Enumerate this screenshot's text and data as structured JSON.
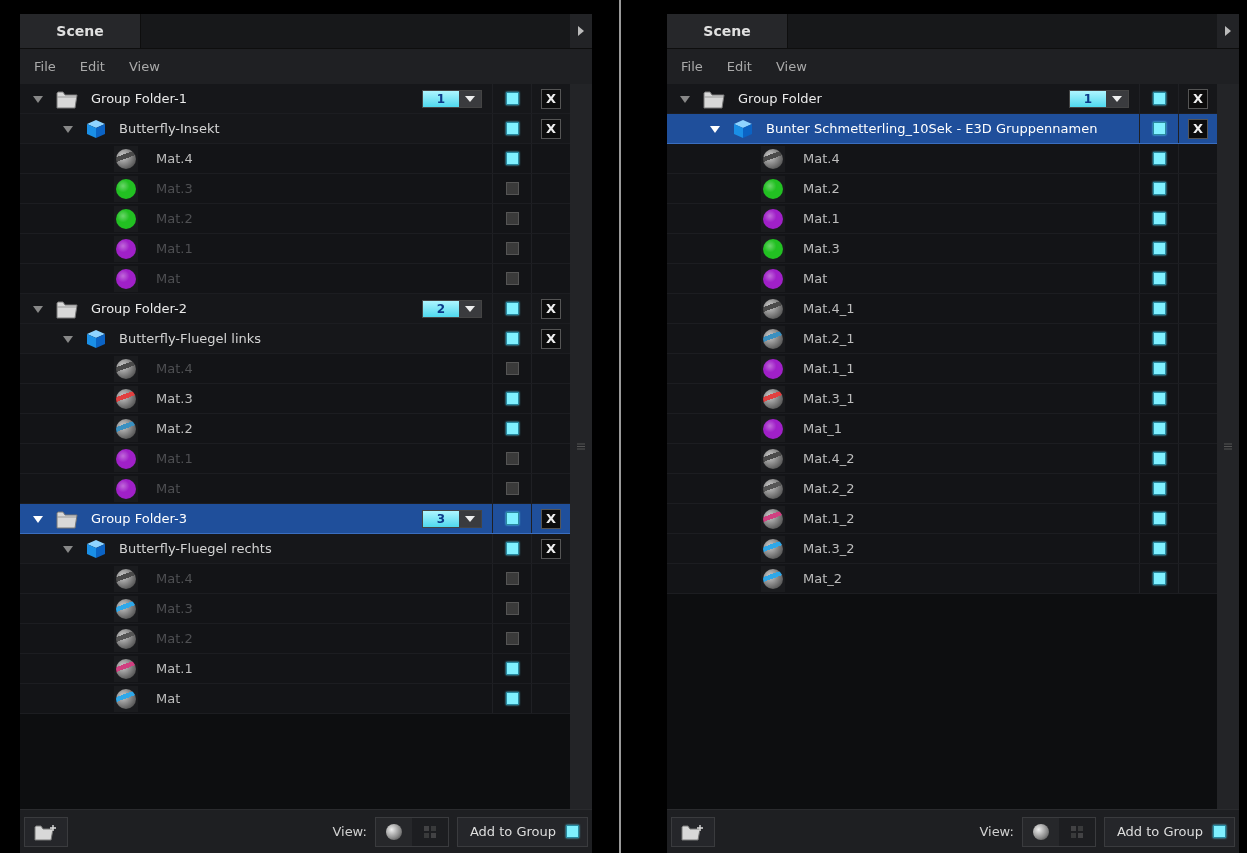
{
  "panels": [
    {
      "tab": "Scene",
      "menu": [
        "File",
        "Edit",
        "View"
      ],
      "groups": [
        {
          "name": "Group Folder-1",
          "layer": "1",
          "close": "X",
          "selected": false,
          "expanded": true,
          "visible": true,
          "objects": [
            {
              "name": "Butterfly-Insekt",
              "close": "X",
              "selected": false,
              "expanded": true,
              "visible": true,
              "materials": [
                {
                  "name": "Mat.4",
                  "kind": "textured",
                  "color": "#4a4a4a",
                  "visible": true
                },
                {
                  "name": "Mat.3",
                  "kind": "solid",
                  "color": "#22c022",
                  "visible": false
                },
                {
                  "name": "Mat.2",
                  "kind": "solid",
                  "color": "#22c022",
                  "visible": false
                },
                {
                  "name": "Mat.1",
                  "kind": "solid",
                  "color": "#a020c8",
                  "visible": false
                },
                {
                  "name": "Mat",
                  "kind": "solid",
                  "color": "#a020c8",
                  "visible": false
                }
              ]
            }
          ]
        },
        {
          "name": "Group Folder-2",
          "layer": "2",
          "close": "X",
          "selected": false,
          "expanded": true,
          "visible": true,
          "objects": [
            {
              "name": "Butterfly-Fluegel links",
              "close": "X",
              "selected": false,
              "expanded": true,
              "visible": true,
              "materials": [
                {
                  "name": "Mat.4",
                  "kind": "textured",
                  "color": "#4a4a4a",
                  "visible": false
                },
                {
                  "name": "Mat.3",
                  "kind": "textured",
                  "color": "#e04040",
                  "visible": true
                },
                {
                  "name": "Mat.2",
                  "kind": "textured",
                  "color": "#3a90c0",
                  "visible": true
                },
                {
                  "name": "Mat.1",
                  "kind": "solid",
                  "color": "#a020c8",
                  "visible": false
                },
                {
                  "name": "Mat",
                  "kind": "solid",
                  "color": "#a020c8",
                  "visible": false
                }
              ]
            }
          ]
        },
        {
          "name": "Group Folder-3",
          "layer": "3",
          "close": "X",
          "selected": true,
          "expanded": true,
          "visible": true,
          "objects": [
            {
              "name": "Butterfly-Fluegel rechts",
              "close": "X",
              "selected": false,
              "expanded": true,
              "visible": true,
              "materials": [
                {
                  "name": "Mat.4",
                  "kind": "textured",
                  "color": "#4a4a4a",
                  "visible": false
                },
                {
                  "name": "Mat.3",
                  "kind": "textured",
                  "color": "#30a8e8",
                  "visible": false
                },
                {
                  "name": "Mat.2",
                  "kind": "textured",
                  "color": "#555555",
                  "visible": false
                },
                {
                  "name": "Mat.1",
                  "kind": "textured",
                  "color": "#d04080",
                  "visible": true
                },
                {
                  "name": "Mat",
                  "kind": "textured",
                  "color": "#30a8e8",
                  "visible": true
                }
              ]
            }
          ]
        }
      ],
      "footer": {
        "view_label": "View:",
        "view_modes": [
          {
            "kind": "sphere",
            "selected": true
          },
          {
            "kind": "cubes",
            "selected": false
          }
        ],
        "add_button": "Add to Group",
        "add_checked": true
      }
    },
    {
      "tab": "Scene",
      "menu": [
        "File",
        "Edit",
        "View"
      ],
      "groups": [
        {
          "name": "Group Folder",
          "layer": "1",
          "close": "X",
          "selected": false,
          "expanded": true,
          "visible": true,
          "objects": [
            {
              "name": "Bunter Schmetterling_10Sek - E3D Gruppennamen",
              "close": "X",
              "selected": true,
              "expanded": true,
              "visible": true,
              "materials": [
                {
                  "name": "Mat.4",
                  "kind": "textured",
                  "color": "#4a4a4a",
                  "visible": true
                },
                {
                  "name": "Mat.2",
                  "kind": "solid",
                  "color": "#22c022",
                  "visible": true
                },
                {
                  "name": "Mat.1",
                  "kind": "solid",
                  "color": "#a020c8",
                  "visible": true
                },
                {
                  "name": "Mat.3",
                  "kind": "solid",
                  "color": "#22c022",
                  "visible": true
                },
                {
                  "name": "Mat",
                  "kind": "solid",
                  "color": "#a020c8",
                  "visible": true
                },
                {
                  "name": "Mat.4_1",
                  "kind": "textured",
                  "color": "#4a4a4a",
                  "visible": true
                },
                {
                  "name": "Mat.2_1",
                  "kind": "textured",
                  "color": "#3a90c0",
                  "visible": true
                },
                {
                  "name": "Mat.1_1",
                  "kind": "solid",
                  "color": "#a020c8",
                  "visible": true
                },
                {
                  "name": "Mat.3_1",
                  "kind": "textured",
                  "color": "#e04040",
                  "visible": true
                },
                {
                  "name": "Mat_1",
                  "kind": "solid",
                  "color": "#a020c8",
                  "visible": true
                },
                {
                  "name": "Mat.4_2",
                  "kind": "textured",
                  "color": "#4a4a4a",
                  "visible": true
                },
                {
                  "name": "Mat.2_2",
                  "kind": "textured",
                  "color": "#555555",
                  "visible": true
                },
                {
                  "name": "Mat.1_2",
                  "kind": "textured",
                  "color": "#d04080",
                  "visible": true
                },
                {
                  "name": "Mat.3_2",
                  "kind": "textured",
                  "color": "#30a8e8",
                  "visible": true
                },
                {
                  "name": "Mat_2",
                  "kind": "textured",
                  "color": "#30a8e8",
                  "visible": true
                }
              ]
            }
          ]
        }
      ],
      "footer": {
        "view_label": "View:",
        "view_modes": [
          {
            "kind": "sphere",
            "selected": true
          },
          {
            "kind": "cubes",
            "selected": false
          }
        ],
        "add_button": "Add to Group",
        "add_checked": true
      }
    }
  ]
}
